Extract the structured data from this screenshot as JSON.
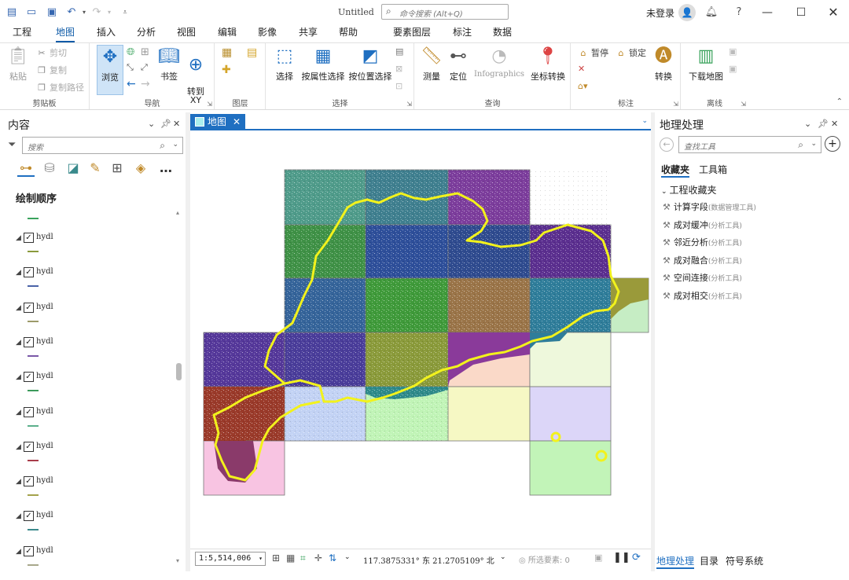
{
  "app": {
    "title": "Untitled",
    "search_placeholder": "命令搜索 (Alt+Q)",
    "user": "未登录"
  },
  "tabs": [
    "工程",
    "地图",
    "插入",
    "分析",
    "视图",
    "编辑",
    "影像",
    "共享",
    "帮助",
    "要素图层",
    "标注",
    "数据"
  ],
  "ribbon": {
    "clipboard": {
      "label": "剪贴板",
      "paste": "粘贴",
      "cut": "剪切",
      "copy": "复制",
      "copy_path": "复制路径"
    },
    "navigate": {
      "label": "导航",
      "explore": "浏览",
      "bookmarks": "书签",
      "goto_xy": "转到\nXY"
    },
    "layer": {
      "label": "图层"
    },
    "selection": {
      "label": "选择",
      "select": "选择",
      "select_by_attr": "按属性选择",
      "select_by_loc": "按位置选择"
    },
    "inquiry": {
      "label": "查询",
      "measure": "测量",
      "locate": "定位",
      "infographics": "Infographics",
      "convert_coords": "坐标转换"
    },
    "labeling": {
      "label": "标注",
      "pause": "暂停",
      "lock": "锁定",
      "convert": "转换"
    },
    "offline": {
      "label": "离线",
      "download_map": "下载地图"
    }
  },
  "contents": {
    "title": "内容",
    "search_placeholder": "搜索",
    "draw_order": "绘制顺序",
    "layers": [
      {
        "name": "hydl",
        "color": "#8a9a3c"
      },
      {
        "name": "hydl",
        "color": "#4a63a8"
      },
      {
        "name": "hydl",
        "color": "#9c9a6a"
      },
      {
        "name": "hydl",
        "color": "#7a58a8"
      },
      {
        "name": "hydl",
        "color": "#3c9a5c"
      },
      {
        "name": "hydl",
        "color": "#5cb08c"
      },
      {
        "name": "hydl",
        "color": "#a83c4a"
      },
      {
        "name": "hydl",
        "color": "#a4a24c"
      },
      {
        "name": "hydl",
        "color": "#3c8a8c"
      },
      {
        "name": "hydl",
        "color": "#a8a88c"
      }
    ],
    "top_symbol_color": "#3aa35c"
  },
  "map": {
    "tab": "地图",
    "scale": "1:5,514,006",
    "coords": "117.3875331° 东 21.2705109° 北",
    "selected_features": "所选要素: 0"
  },
  "geoprocessing": {
    "title": "地理处理",
    "search_placeholder": "查找工具",
    "tabs": [
      "收藏夹",
      "工具箱"
    ],
    "favorites_header": "工程收藏夹",
    "tools": [
      {
        "name": "计算字段",
        "box": "(数据管理工具)"
      },
      {
        "name": "成对缓冲",
        "box": "(分析工具)"
      },
      {
        "name": "邻近分析",
        "box": "(分析工具)"
      },
      {
        "name": "成对融合",
        "box": "(分析工具)"
      },
      {
        "name": "空间连接",
        "box": "(分析工具)"
      },
      {
        "name": "成对相交",
        "box": "(分析工具)"
      }
    ],
    "bottom_tabs": [
      "地理处理",
      "目录",
      "符号系统"
    ]
  }
}
